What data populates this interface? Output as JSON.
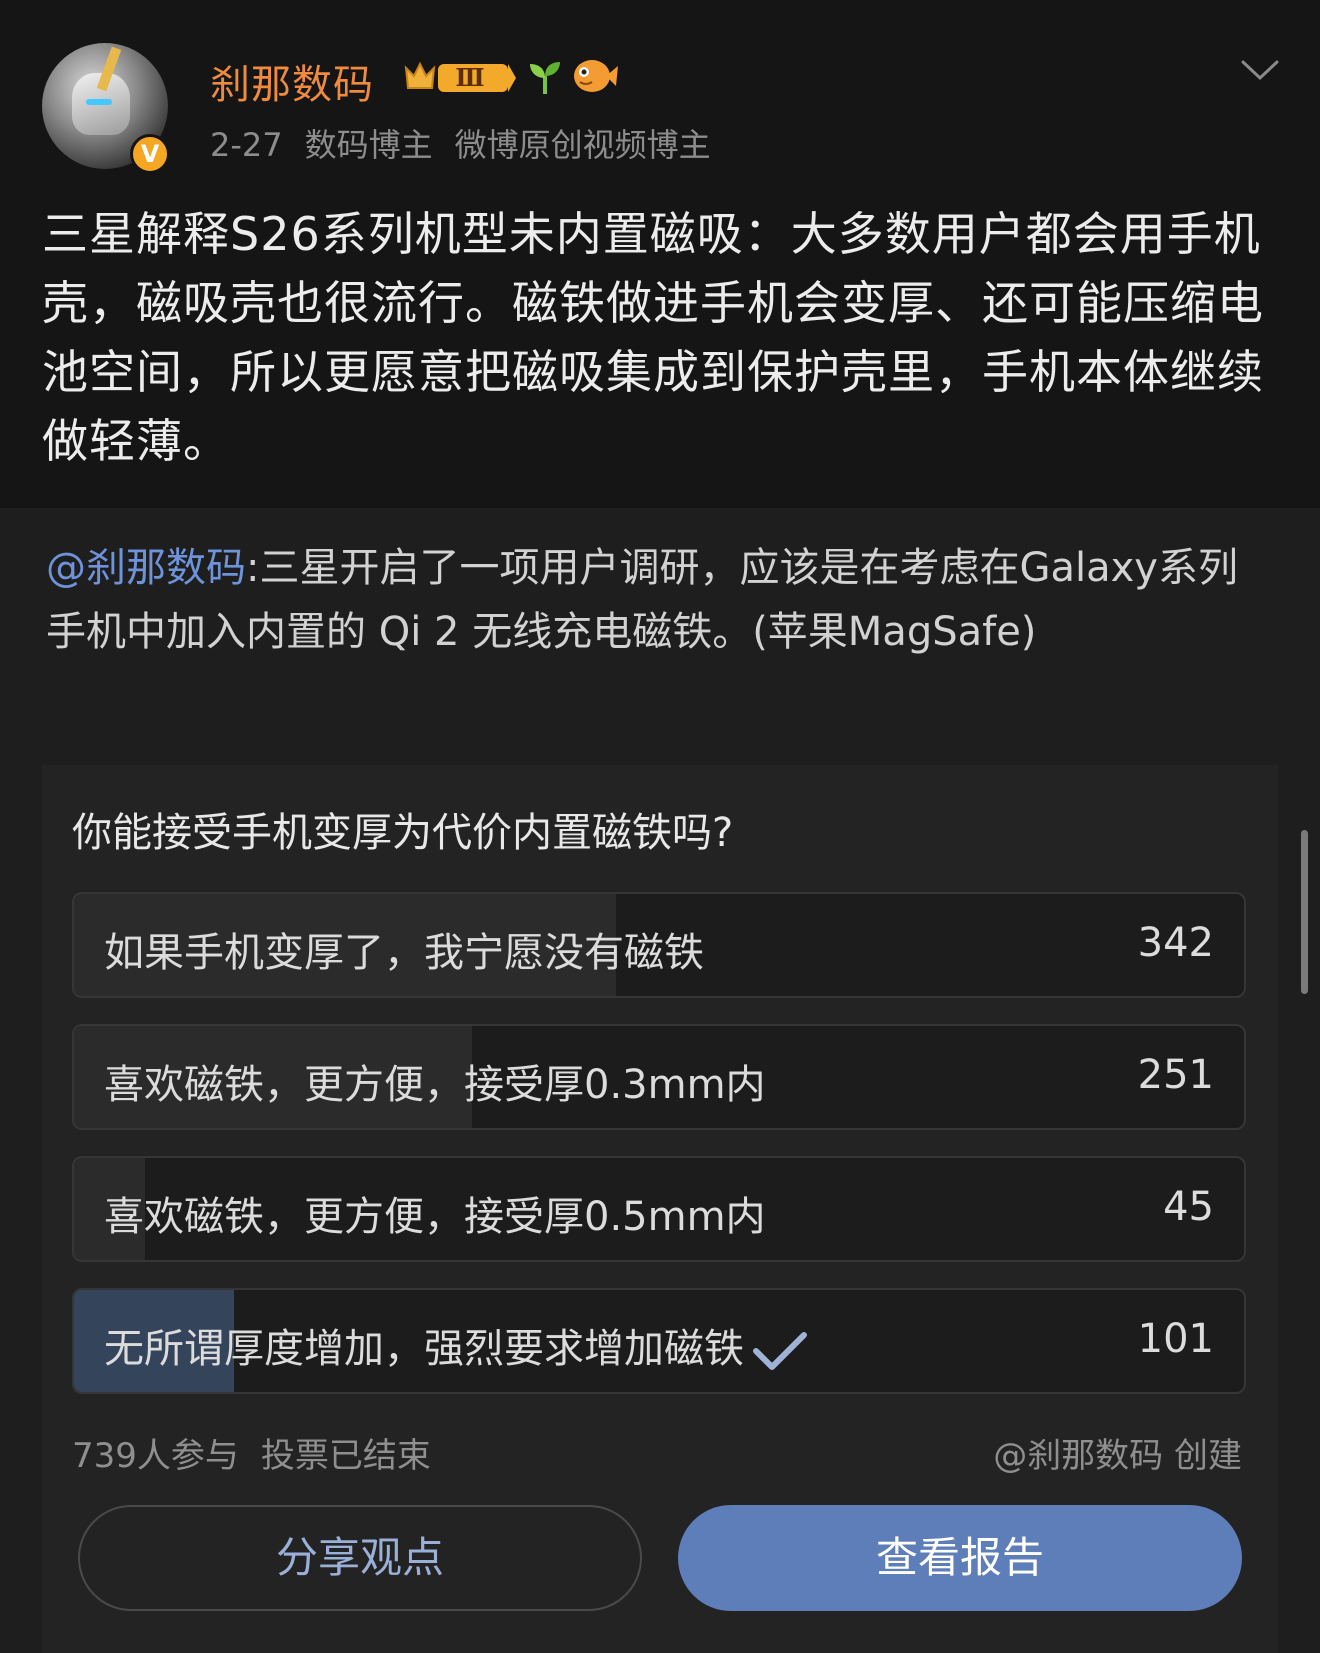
{
  "header": {
    "username": "刹那数码",
    "date": "2-27",
    "tags": [
      "数码博主",
      "微博原创视频博主"
    ],
    "level_badge": "Ⅲ",
    "verified_badge": "V",
    "icons": [
      "crown-level-badge-icon",
      "sprout-icon",
      "fish-icon",
      "chevron-down-icon"
    ]
  },
  "post": {
    "text": "三星解释S26系列机型未内置磁吸：大多数用户都会用手机壳，磁吸壳也很流行。磁铁做进手机会变厚、还可能压缩电池空间，所以更愿意把磁吸集成到保护壳里，手机本体继续做轻薄。"
  },
  "repost": {
    "mention": "@刹那数码",
    "text": ":三星开启了一项用户调研，应该是在考虑在Galaxy系列手机中加入内置的 Qi 2 无线充电磁铁。(苹果MagSafe)"
  },
  "poll": {
    "question": "你能接受手机变厚为代价内置磁铁吗?",
    "total_votes": 739,
    "options": [
      {
        "label": "如果手机变厚了，我宁愿没有磁铁",
        "count": "342",
        "share": 0.463,
        "selected": false
      },
      {
        "label": "喜欢磁铁，更方便，接受厚0.3mm内",
        "count": "251",
        "share": 0.34,
        "selected": false
      },
      {
        "label": "喜欢磁铁，更方便，接受厚0.5mm内",
        "count": "45",
        "share": 0.061,
        "selected": false
      },
      {
        "label": "无所谓厚度增加，强烈要求增加磁铁",
        "count": "101",
        "share": 0.137,
        "selected": true
      }
    ],
    "participants_label": "739人参与",
    "status_label": "投票已结束",
    "creator_label": "@刹那数码 创建",
    "share_button": "分享观点",
    "report_button": "查看报告"
  },
  "colors": {
    "accent_blue": "#5e7eb9",
    "username_orange": "#f08a3c",
    "mention_blue": "#6f93d8"
  }
}
